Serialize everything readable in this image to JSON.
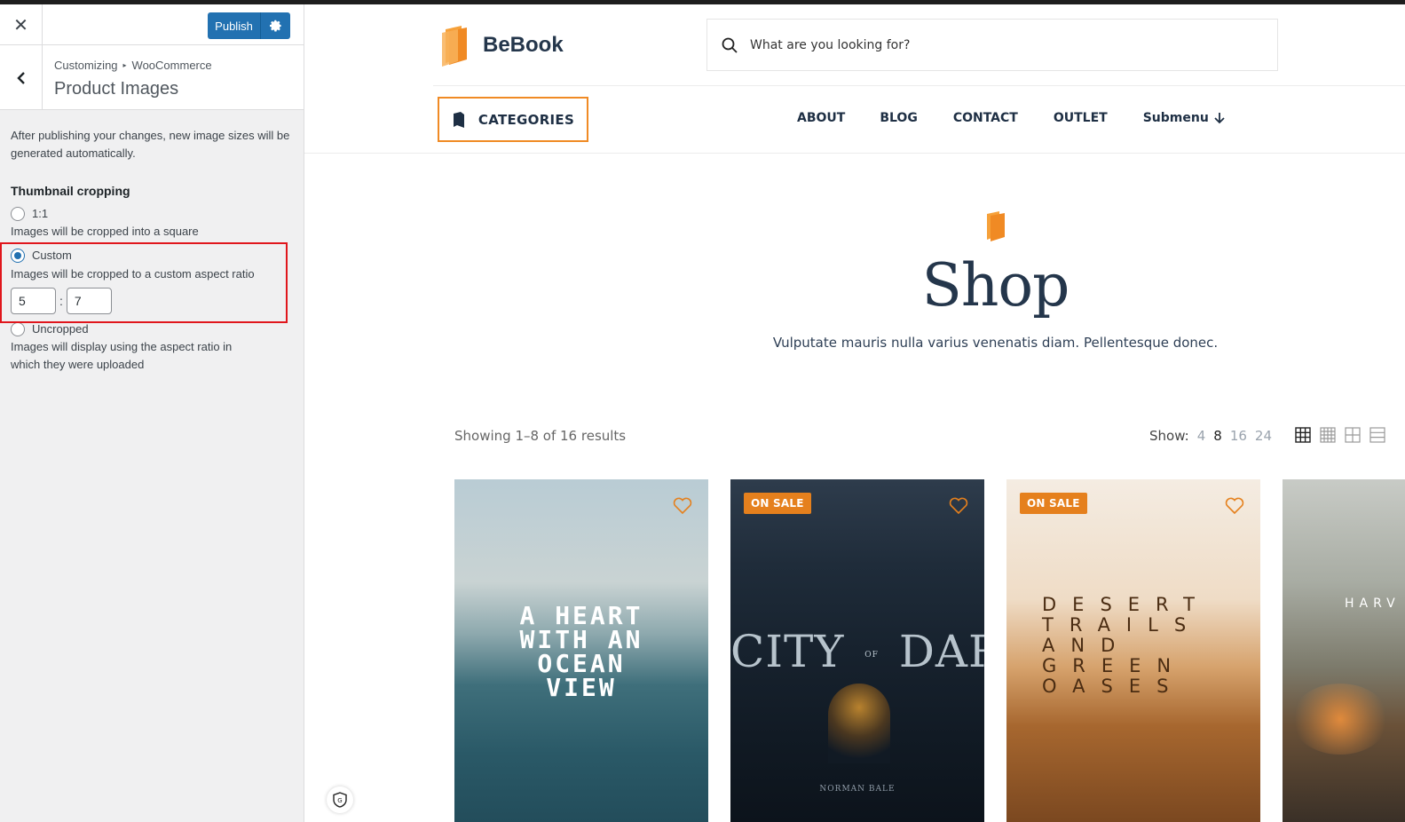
{
  "customizer": {
    "close_label": "✕",
    "publish_label": "Publish",
    "breadcrumb": {
      "root": "Customizing",
      "section": "WooCommerce"
    },
    "section_title": "Product Images",
    "description": "After publishing your changes, new image sizes will be generated automatically.",
    "thumbnail_label": "Thumbnail cropping",
    "options": [
      {
        "label": "1:1",
        "description": "Images will be cropped into a square",
        "checked": false
      },
      {
        "label": "Custom",
        "description": "Images will be cropped to a custom aspect ratio",
        "checked": true
      },
      {
        "label": "Uncropped",
        "description": "Images will display using the aspect ratio in which they were uploaded",
        "checked": false
      }
    ],
    "ratio_width": "5",
    "ratio_height": "7",
    "ratio_separator": ":"
  },
  "site": {
    "logo_text": "BeBook",
    "search_placeholder": "What are you looking for?",
    "categories_label": "CATEGORIES",
    "nav": [
      "ABOUT",
      "BLOG",
      "CONTACT",
      "OUTLET",
      "Submenu"
    ],
    "shop_title": "Shop",
    "shop_subtitle": "Vulputate mauris nulla varius venenatis diam. Pellentesque donec.",
    "results_text": "Showing 1–8 of 16 results",
    "show_label": "Show:",
    "show_options": [
      "4",
      "8",
      "16",
      "24"
    ],
    "show_active": "8",
    "badge_label": "ON SALE",
    "accent_color": "#e5801d",
    "products": [
      {
        "cover_text": "A HEART WITH AN OCEAN VIEW",
        "on_sale": false
      },
      {
        "cover_text": "CITY",
        "cover_small": "OF",
        "cover_text2": "DARK",
        "author": "NORMAN BALE",
        "on_sale": true
      },
      {
        "cover_text": "DESERT TRAILS AND GREEN OASES",
        "on_sale": true
      },
      {
        "cover_text": "HARV",
        "on_sale": false
      }
    ]
  }
}
